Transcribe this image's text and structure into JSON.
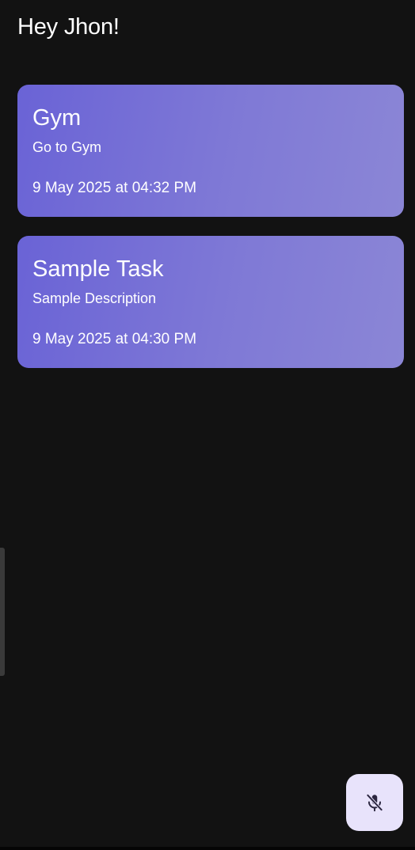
{
  "header": {
    "greeting": "Hey Jhon!"
  },
  "tasks": [
    {
      "title": "Gym",
      "description": "Go to Gym",
      "datetime": "9 May 2025 at 04:32 PM"
    },
    {
      "title": "Sample Task",
      "description": "Sample Description",
      "datetime": "9 May 2025 at 04:30 PM"
    }
  ],
  "fab": {
    "icon": "mic-off-icon"
  },
  "colors": {
    "background": "#121212",
    "card_gradient_start": "#6a63d6",
    "card_gradient_end": "#8b86d6",
    "fab_background": "#e8e3fb",
    "fab_icon": "#2b2640"
  }
}
